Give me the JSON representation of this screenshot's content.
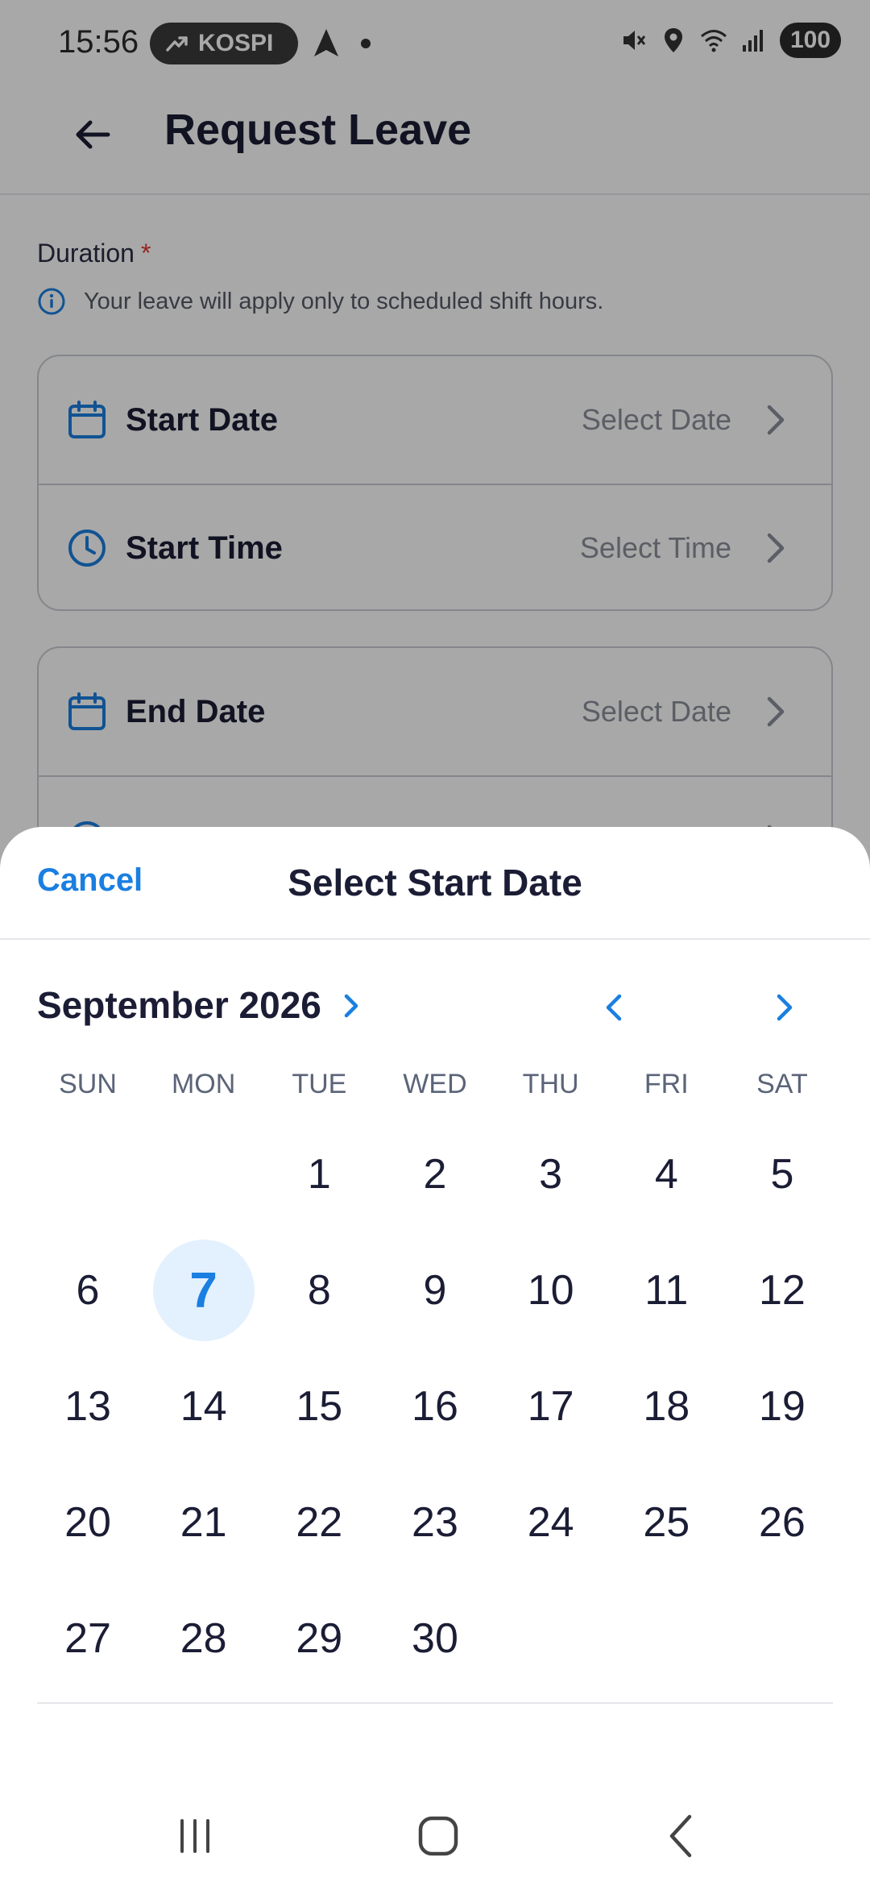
{
  "status_bar": {
    "time": "15:56",
    "ticker": "KOSPI",
    "battery": "100"
  },
  "header": {
    "title": "Request Leave"
  },
  "form": {
    "duration_label": "Duration",
    "required_mark": "*",
    "info_text": "Your leave will apply only to scheduled shift hours.",
    "start_date": {
      "label": "Start Date",
      "value": "Select Date"
    },
    "start_time": {
      "label": "Start Time",
      "value": "Select Time"
    },
    "end_date": {
      "label": "End Date",
      "value": "Select Date"
    }
  },
  "date_picker": {
    "cancel_label": "Cancel",
    "title": "Select Start Date",
    "month_label": "September 2026",
    "weekdays": [
      "SUN",
      "MON",
      "TUE",
      "WED",
      "THU",
      "FRI",
      "SAT"
    ],
    "weeks": [
      [
        "",
        "",
        "1",
        "2",
        "3",
        "4",
        "5"
      ],
      [
        "6",
        "7",
        "8",
        "9",
        "10",
        "11",
        "12"
      ],
      [
        "13",
        "14",
        "15",
        "16",
        "17",
        "18",
        "19"
      ],
      [
        "20",
        "21",
        "22",
        "23",
        "24",
        "25",
        "26"
      ],
      [
        "27",
        "28",
        "29",
        "30",
        "",
        "",
        ""
      ]
    ],
    "selected_day": "7"
  },
  "colors": {
    "accent": "#1a7fe0",
    "selected_bg": "#e3f0fd",
    "text_dark": "#1b1d35"
  }
}
